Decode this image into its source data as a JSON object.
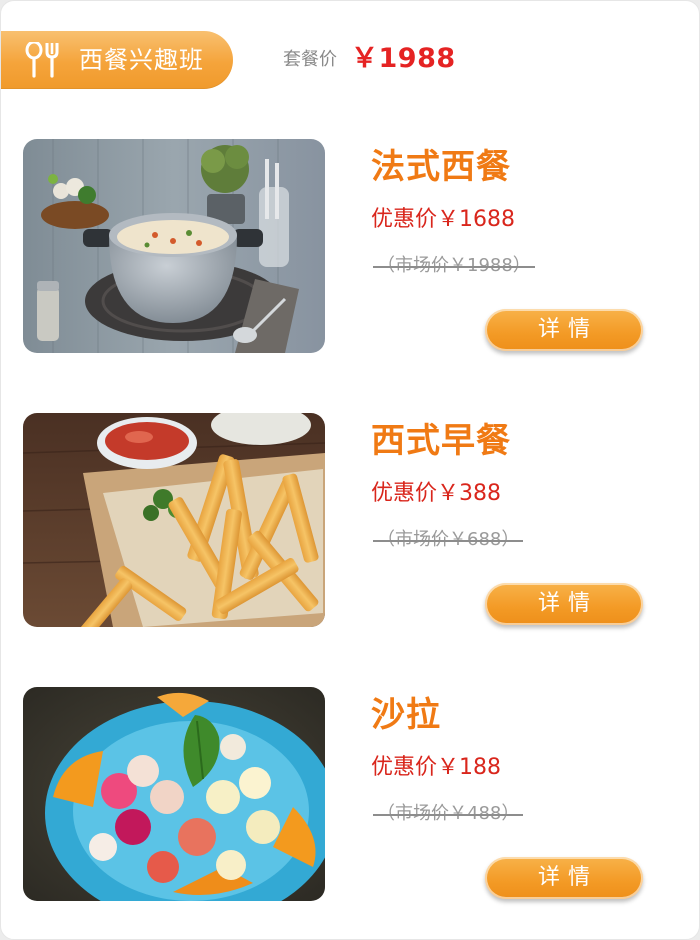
{
  "header": {
    "title": "西餐兴趣班",
    "icon": "utensils-icon",
    "price_label": "套餐价",
    "price_value": "￥1988"
  },
  "items": [
    {
      "name": "法式西餐",
      "promo_price": "优惠价￥1688",
      "market_price": "（市场价￥1988）",
      "detail_label": "详情",
      "image": "cream-soup-pot-photo"
    },
    {
      "name": "西式早餐",
      "promo_price": "优惠价￥388",
      "market_price": "（市场价￥688）",
      "detail_label": "详情",
      "image": "french-fries-photo"
    },
    {
      "name": "沙拉",
      "promo_price": "优惠价￥188",
      "market_price": "（市场价￥488）",
      "detail_label": "详情",
      "image": "fruit-salad-photo"
    }
  ],
  "colors": {
    "accent_orange": "#f5a43b",
    "title_orange": "#f07a14",
    "price_red": "#e52323",
    "promo_red": "#d9261c",
    "muted_gray": "#9a9a9a"
  }
}
